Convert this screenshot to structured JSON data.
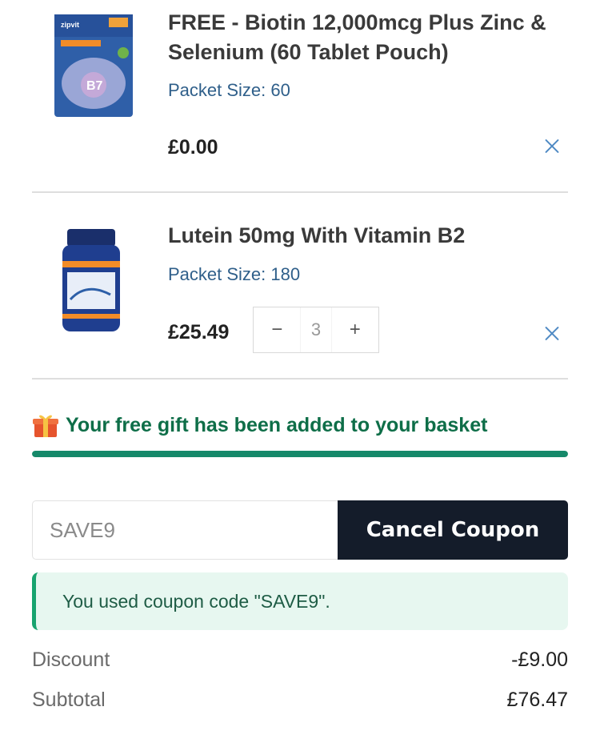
{
  "basket": {
    "items": [
      {
        "title": "FREE - Biotin 12,000mcg Plus Zinc & Selenium (60 Tablet Pouch)",
        "packet_size": "Packet Size: 60",
        "price": "£0.00",
        "thumb_label": "B7",
        "thumb_brand": "zipvit",
        "thumb_color": "#2f5fa8"
      },
      {
        "title": "Lutein 50mg With Vitamin B2",
        "packet_size": "Packet Size: 180",
        "price": "£25.49",
        "quantity": "3",
        "thumb_color": "#1f3e8f"
      }
    ],
    "stepper": {
      "minus": "−",
      "plus": "+"
    }
  },
  "free_gift": {
    "icon": "gift-icon",
    "message": "Your free gift has been added to your basket",
    "progress": 1.0,
    "progress_color": "#16896a"
  },
  "coupon": {
    "value": "SAVE9",
    "button_label": "Cancel Coupon",
    "notice": "You used coupon code \"SAVE9\"."
  },
  "summary": {
    "discount_label": "Discount",
    "discount_value": "-£9.00",
    "subtotal_label": "Subtotal",
    "subtotal_value": "£76.47"
  },
  "colors": {
    "accent_green": "#0e6e48",
    "link_blue": "#2f5f8a",
    "button_dark": "#141c2a",
    "notice_bg": "#e7f7f0"
  }
}
